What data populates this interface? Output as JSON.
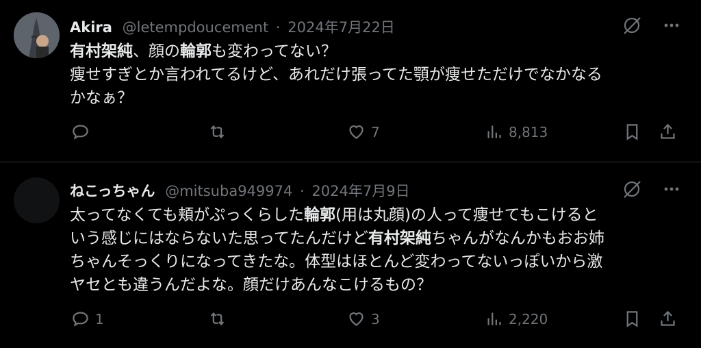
{
  "tweets": [
    {
      "name": "Akira",
      "handle": "@letempdoucement",
      "sep": "·",
      "date": "2024年7月22日",
      "body": {
        "t1": "有村架純",
        "t2": "、顔の",
        "t3": "輪郭",
        "t4": "も変わってない？",
        "t5": "痩せすぎとか言われてるけど、あれだけ張ってた顎が痩せただけでなかなる",
        "t6": "かなぁ？"
      },
      "actions": {
        "replies": "",
        "retweets": "",
        "likes": "7",
        "views": "8,813"
      }
    },
    {
      "name": "ねこっちゃん",
      "handle": "@mitsuba949974",
      "sep": "·",
      "date": "2024年7月9日",
      "body": {
        "l1a": "太ってなくても頬がぷっくらした",
        "l1b": "輪郭",
        "l1c": "(用は丸顔)の人って痩せてもこけると",
        "l2a": "いう感じにはならないた思ってたんだけど",
        "l2b": "有村架純",
        "l2c": "ちゃんがなんかもおお姉",
        "l3": "ちゃんそっくりになってきたな。体型はほとんど変わってないっぽいから激",
        "l4": "ヤセとも違うんだよな。顔だけあんなこけるもの？"
      },
      "actions": {
        "replies": "1",
        "retweets": "",
        "likes": "3",
        "views": "2,220"
      }
    }
  ],
  "icons": {
    "grok": "grok-icon",
    "more": "more-icon",
    "reply": "reply-icon",
    "retweet": "retweet-icon",
    "like": "heart-icon",
    "views": "views-icon",
    "bookmark": "bookmark-icon",
    "share": "share-icon"
  },
  "colors": {
    "background": "#000000",
    "text": "#e7e9ea",
    "secondary": "#71767b",
    "divider": "#2f3336"
  }
}
